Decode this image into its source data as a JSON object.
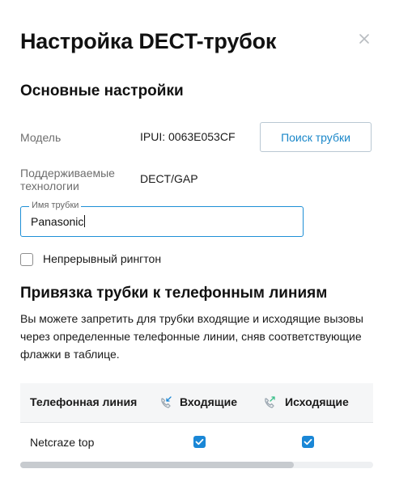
{
  "dialog": {
    "title": "Настройка DECT-трубок",
    "close_icon": "close-icon"
  },
  "basic": {
    "section_title": "Основные настройки",
    "model_label": "Модель",
    "model_value": "IPUI: 0063E053CF",
    "find_button": "Поиск трубки",
    "tech_label_line1": "Поддерживаемые",
    "tech_label_line2": "технологии",
    "tech_value": "DECT/GAP",
    "name_field_label": "Имя трубки",
    "name_field_value": "Panasonic",
    "continuous_ring_label": "Непрерывный рингтон",
    "continuous_ring_checked": false
  },
  "binding": {
    "section_title": "Привязка трубки к телефонным линиям",
    "description": "Вы можете запретить для трубки входящие и исходящие вызовы через определенные телефонные линии, сняв соответствующие флажки в таблице.",
    "table": {
      "columns": [
        "Телефонная линия",
        "Входящие",
        "Исходящие"
      ],
      "column_icons": [
        "incoming-call-icon",
        "outgoing-call-icon"
      ],
      "rows": [
        {
          "line": "Netcraze top",
          "incoming": true,
          "outgoing": true
        }
      ]
    }
  },
  "colors": {
    "accent": "#1a87d6",
    "field_border": "#1e8fd6",
    "icon_muted": "#9aa6b0"
  }
}
